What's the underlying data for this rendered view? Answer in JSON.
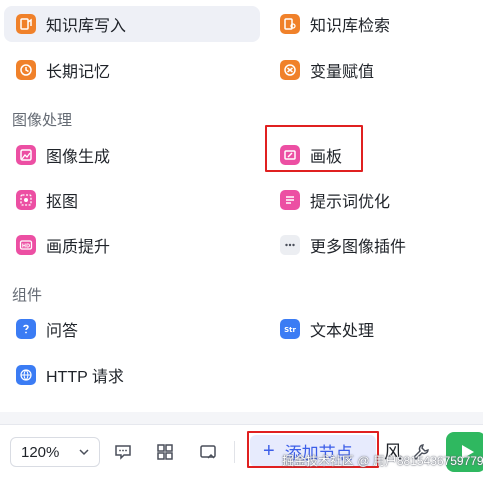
{
  "menu": {
    "top_items": [
      {
        "label": "知识库写入",
        "icon": "knowledge-write-icon",
        "color": "#f0812a",
        "active": true
      },
      {
        "label": "知识库检索",
        "icon": "knowledge-search-icon",
        "color": "#f0812a",
        "active": false
      },
      {
        "label": "长期记忆",
        "icon": "long-term-memory-icon",
        "color": "#f0812a",
        "active": false
      },
      {
        "label": "变量赋值",
        "icon": "variable-assign-icon",
        "color": "#f0812a",
        "active": false
      }
    ],
    "sections": [
      {
        "title": "图像处理",
        "items": [
          {
            "label": "图像生成",
            "icon": "image-generate-icon",
            "color": "#ec4fa3"
          },
          {
            "label": "画板",
            "icon": "canvas-board-icon",
            "color": "#ec4fa3",
            "highlighted": true
          },
          {
            "label": "抠图",
            "icon": "cutout-icon",
            "color": "#ec4fa3"
          },
          {
            "label": "提示词优化",
            "icon": "prompt-optimize-icon",
            "color": "#ec4fa3"
          },
          {
            "label": "画质提升",
            "icon": "hd-enhance-icon",
            "color": "#ec4fa3"
          },
          {
            "label": "更多图像插件",
            "icon": "more-icon",
            "color": "#eceef2"
          }
        ]
      },
      {
        "title": "组件",
        "items": [
          {
            "label": "问答",
            "icon": "question-icon",
            "color": "#3b7cf4"
          },
          {
            "label": "文本处理",
            "icon": "text-process-icon",
            "color": "#3b7cf4"
          },
          {
            "label": "HTTP 请求",
            "icon": "http-icon",
            "color": "#3b7cf4"
          }
        ]
      }
    ]
  },
  "toolbar": {
    "zoom_value": "120%",
    "add_node_label": "添加节点",
    "add_node_icon": "plus-icon",
    "partial_label": "风",
    "run_icon": "play-icon",
    "accent": "#3c5ee8",
    "run_color": "#2fb860"
  },
  "watermark": "掘金技术社区 @ 用户8815436759779"
}
